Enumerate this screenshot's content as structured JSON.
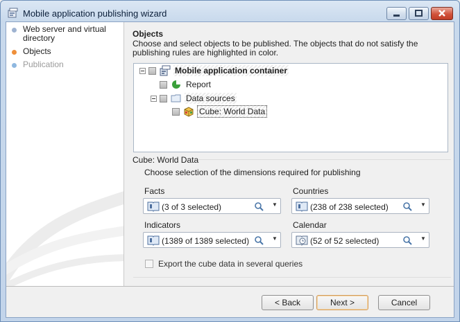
{
  "window": {
    "title": "Mobile application publishing wizard"
  },
  "steps": [
    {
      "label": "Web server and virtual directory",
      "color": "#9fb3d1",
      "state": "done"
    },
    {
      "label": "Objects",
      "color": "#ef8f3a",
      "state": "current"
    },
    {
      "label": "Publication",
      "color": "#8fb8e0",
      "state": "pending"
    }
  ],
  "objects": {
    "title": "Objects",
    "description": "Choose and select objects to be published. The objects that do not satisfy the publishing rules are highlighted in color.",
    "tree": [
      {
        "label": "Mobile application container",
        "icon": "container-icon",
        "expanded": true
      },
      {
        "label": "Report",
        "icon": "report-icon"
      },
      {
        "label": "Data sources",
        "icon": "folder-icon",
        "expanded": true
      },
      {
        "label": "Cube: World Data",
        "icon": "cube-icon",
        "selected": true
      }
    ]
  },
  "cube": {
    "label": "Cube: World Data",
    "description": "Choose selection of the dimensions required for publishing",
    "dimensions": [
      {
        "label": "Facts",
        "value": "(3 of 3 selected)",
        "icon": "dimension-icon"
      },
      {
        "label": "Countries",
        "value": "(238 of 238 selected)",
        "icon": "dimension-icon"
      },
      {
        "label": "Indicators",
        "value": "(1389 of 1389 selected)",
        "icon": "dimension-icon"
      },
      {
        "label": "Calendar",
        "value": "(52 of 52 selected)",
        "icon": "calendar-dimension-icon"
      }
    ],
    "export_label": "Export the cube data in several queries"
  },
  "buttons": {
    "back": "< Back",
    "next": "Next >",
    "cancel": "Cancel"
  },
  "colors": {
    "hatch": "#ececec",
    "accent": "#ef8f3a"
  }
}
